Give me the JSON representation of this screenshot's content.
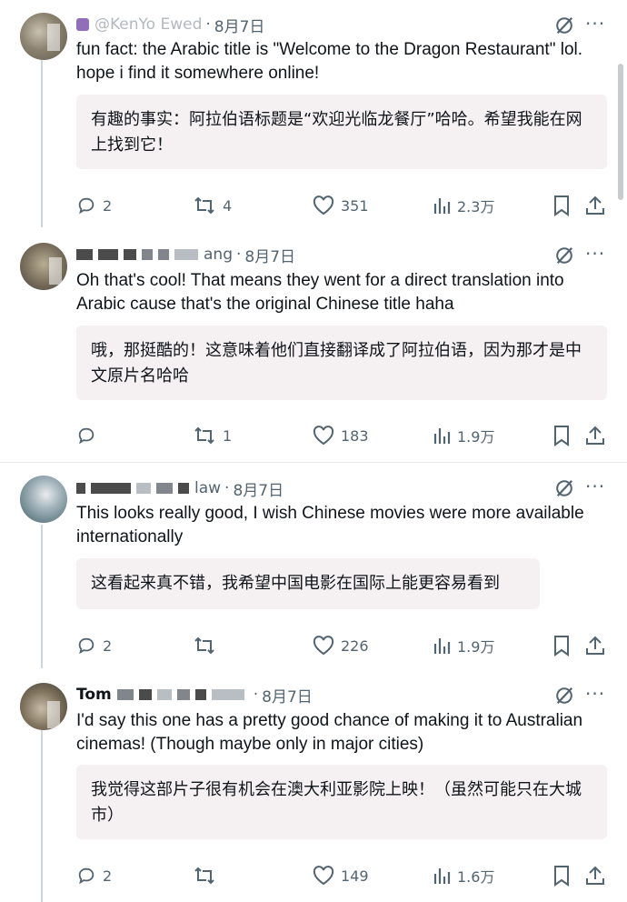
{
  "posts": [
    {
      "handle": "@KenYo  Ewed",
      "sep": "·",
      "date": "8月7日",
      "text": "fun fact: the Arabic title is \"Welcome to the Dragon Restaurant\" lol. hope i find it somewhere online!",
      "translation": "有趣的事实：阿拉伯语标题是“欢迎光临龙餐厅”哈哈。希望我能在网上找到它！",
      "replies": "2",
      "reposts": "4",
      "likes": "351",
      "views": "2.3万"
    },
    {
      "handle": "ang",
      "sep": "·",
      "date": "8月7日",
      "text": "Oh that's cool! That means they went for a direct translation into Arabic cause that's the original Chinese title haha",
      "translation": "哦，那挺酷的！这意味着他们直接翻译成了阿拉伯语，因为那才是中文原片名哈哈",
      "replies": "",
      "reposts": "1",
      "likes": "183",
      "views": "1.9万"
    },
    {
      "handle": "law",
      "sep": "·",
      "date": "8月7日",
      "text": "This looks really good, I wish Chinese movies were more available internationally",
      "translation": "这看起来真不错，我希望中国电影在国际上能更容易看到",
      "replies": "2",
      "reposts": "",
      "likes": "226",
      "views": "1.9万"
    },
    {
      "handle": "Tom",
      "sep": "·",
      "date": "8月7日",
      "text": "I'd say this one has a pretty good chance of making it to Australian cinemas! (Though maybe only in major cities)",
      "translation": "我觉得这部片子很有机会在澳大利亚影院上映！（虽然可能只在大城市）",
      "replies": "2",
      "reposts": "",
      "likes": "149",
      "views": "1.6万"
    }
  ],
  "more_label": "···",
  "icons": [
    "reply-icon",
    "repost-icon",
    "like-icon",
    "views-icon",
    "bookmark-icon",
    "share-icon",
    "grok-icon",
    "more-icon"
  ],
  "colors": {
    "text": "#0f1419",
    "muted": "#536471",
    "translation_bg": "#f5f1f2",
    "divider": "#e6e9eb"
  }
}
